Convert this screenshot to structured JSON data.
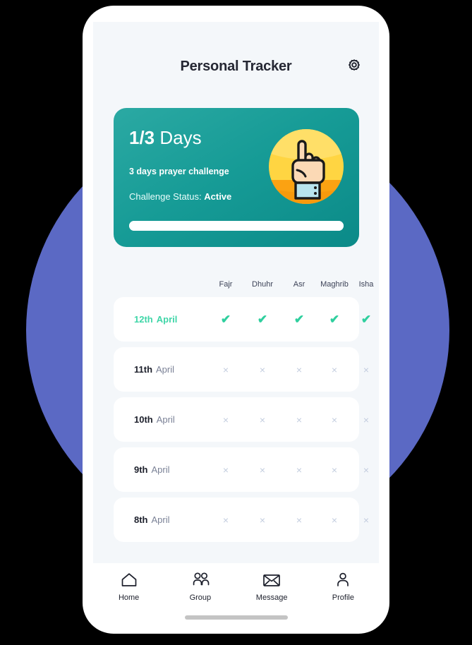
{
  "header": {
    "title": "Personal Tracker",
    "settings_icon": "gear-icon"
  },
  "challenge_card": {
    "days_count": "1/3",
    "days_word": "Days",
    "subtitle": "3 days prayer challenge",
    "status_label": "Challenge Status:",
    "status_value": "Active",
    "progress_percent": 100,
    "illustration": "hand-pointing-up-icon",
    "accent_color": "#169b96",
    "progress_color": "#ffffff"
  },
  "tracker": {
    "columns": [
      "Fajr",
      "Dhuhr",
      "Asr",
      "Maghrib",
      "Isha"
    ],
    "check_glyph": "✔",
    "cross_glyph": "×",
    "check_color": "#2fcf9e",
    "cross_color": "#c3cddf",
    "active_color": "#3fd6a8",
    "rows": [
      {
        "day": "12th",
        "month": "April",
        "active": true,
        "marks": [
          "check",
          "check",
          "check",
          "check",
          "check"
        ]
      },
      {
        "day": "11th",
        "month": "April",
        "active": false,
        "marks": [
          "cross",
          "cross",
          "cross",
          "cross",
          "cross"
        ]
      },
      {
        "day": "10th",
        "month": "April",
        "active": false,
        "marks": [
          "cross",
          "cross",
          "cross",
          "cross",
          "cross"
        ]
      },
      {
        "day": "9th",
        "month": "April",
        "active": false,
        "marks": [
          "cross",
          "cross",
          "cross",
          "cross",
          "cross"
        ]
      },
      {
        "day": "8th",
        "month": "April",
        "active": false,
        "marks": [
          "cross",
          "cross",
          "cross",
          "cross",
          "cross"
        ]
      }
    ]
  },
  "bottom_nav": {
    "items": [
      {
        "label": "Home",
        "icon": "home-icon"
      },
      {
        "label": "Group",
        "icon": "group-icon"
      },
      {
        "label": "Message",
        "icon": "envelope-icon"
      },
      {
        "label": "Profile",
        "icon": "person-icon"
      }
    ]
  },
  "decor": {
    "circle_color": "#5b69c4",
    "screen_background": "#f4f7fa",
    "phone_body": "#ffffff"
  }
}
